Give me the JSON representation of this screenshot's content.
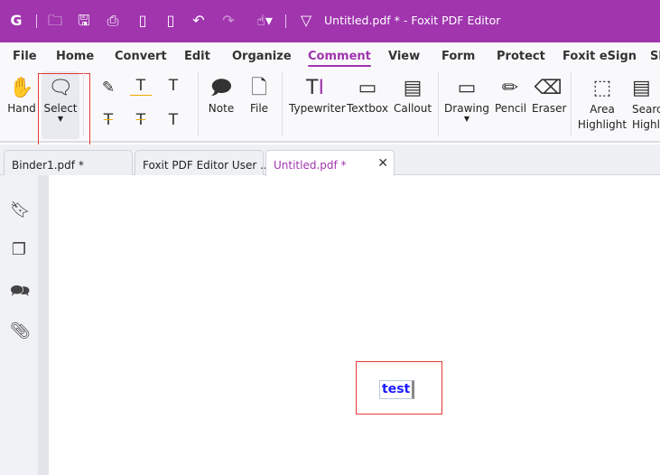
{
  "titlebar": {
    "title": "Untitled.pdf * - Foxit PDF Editor",
    "accent": "#a035ae"
  },
  "menu": [
    "File",
    "Home",
    "Convert",
    "Edit",
    "Organize",
    "Comment",
    "View",
    "Form",
    "Protect",
    "Foxit eSign",
    "Sh"
  ],
  "active_menu": "Comment",
  "tools": {
    "hand": "Hand",
    "select": "Select",
    "note": "Note",
    "file": "File",
    "typewriter": "Typewriter",
    "textbox": "Textbox",
    "callout": "Callout",
    "drawing": "Drawing",
    "pencil": "Pencil",
    "eraser": "Eraser",
    "area1": "Area",
    "area2": "Highlight",
    "search1": "Searc",
    "search2": "Highl"
  },
  "tabs": [
    {
      "label": "Binder1.pdf *"
    },
    {
      "label": "Foxit PDF Editor User ..."
    },
    {
      "label": "Untitled.pdf *"
    }
  ],
  "document": {
    "text": "test"
  }
}
